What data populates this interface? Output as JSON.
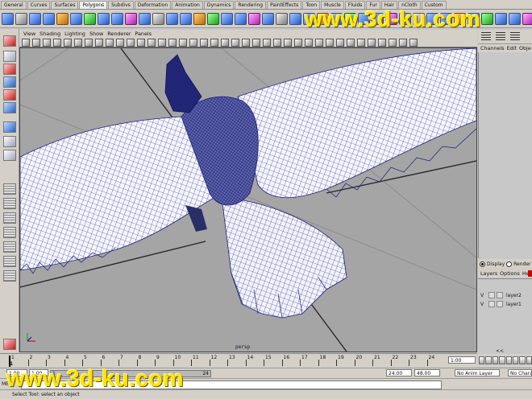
{
  "shelf": {
    "tabs": [
      "General",
      "Curves",
      "Surfaces",
      "Polygons",
      "Subdivs",
      "Deformation",
      "Animation",
      "Dynamics",
      "Rendering",
      "PaintEffects",
      "Toon",
      "Muscle",
      "Fluids",
      "Fur",
      "Hair",
      "nCloth",
      "Custom"
    ],
    "active_tab": "Polygons"
  },
  "panel_menu": [
    "View",
    "Shading",
    "Lighting",
    "Show",
    "Renderer",
    "Panels"
  ],
  "viewport": {
    "camera": "persp",
    "background": "#a5a5a5",
    "wire_color": "#1a1f7a",
    "mesh_color": "#ffffff"
  },
  "channel_box": {
    "menu": [
      "Channels",
      "Edit",
      "Obje"
    ]
  },
  "layer_editor": {
    "display_label": "Display",
    "render_label": "Render",
    "menu": [
      "Layers",
      "Options",
      "He"
    ],
    "layers": [
      {
        "visible": "V",
        "name": "layer2"
      },
      {
        "visible": "V",
        "name": "layer1"
      }
    ]
  },
  "time_slider": {
    "ticks": [
      "1",
      "2",
      "3",
      "4",
      "5",
      "6",
      "7",
      "8",
      "9",
      "10",
      "11",
      "12",
      "13",
      "14",
      "15",
      "16",
      "17",
      "18",
      "19",
      "20",
      "21",
      "22",
      "23",
      "24"
    ],
    "current_frame": "1.00",
    "playhead_frame": "1"
  },
  "range_slider": {
    "start_time": "1.00",
    "playback_start": "1.00",
    "range_start": "1",
    "range_end": "24",
    "playback_end": "24.00",
    "end_time": "48.00",
    "anim_layer": "No Anim Layer",
    "character": "No Charac"
  },
  "command_line": {
    "label": "MEL",
    "value": ""
  },
  "help_line": {
    "text": "Select Tool: select an object"
  },
  "watermarks": {
    "top": "www.3d-ku.com",
    "bottom": "www.3d-ku.com"
  }
}
